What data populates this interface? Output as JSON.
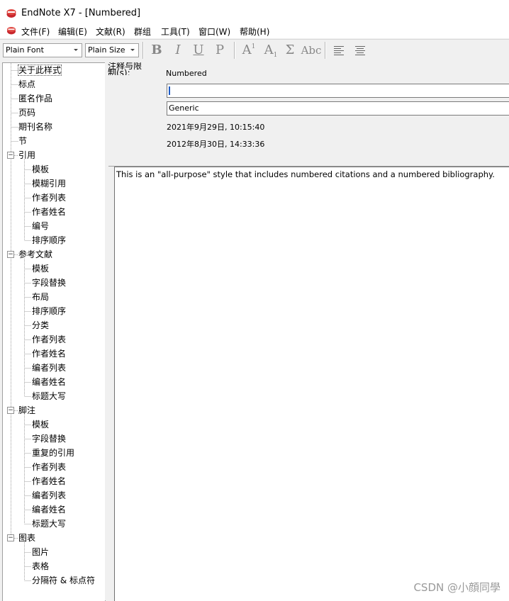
{
  "title_bar": {
    "title": "EndNote X7 - [Numbered]"
  },
  "menu": [
    "文件(F)",
    "编辑(E)",
    "文献(R)",
    "群组",
    "工具(T)",
    "窗口(W)",
    "帮助(H)"
  ],
  "toolbar": {
    "font_value": "Plain Font",
    "size_value": "Plain Size",
    "buttons": {
      "bold": "B",
      "italic": "I",
      "underline": "U",
      "plain": "P",
      "superscript": "A",
      "superscript_mark": "1",
      "subscript": "A",
      "subscript_mark": "1",
      "symbol": "Σ",
      "small_caps": "Abc"
    }
  },
  "tree": {
    "about": "关于此样式",
    "anonymous": "匿名作品",
    "page_numbers": "页码",
    "journal_names": "期刊名称",
    "sections": "节",
    "citations": {
      "label": "引用",
      "children": [
        "模板",
        "模糊引用",
        "作者列表",
        "作者姓名",
        "编号",
        "排序顺序"
      ]
    },
    "bibliography": {
      "label": "参考文献",
      "children": [
        "模板",
        "字段替换",
        "布局",
        "排序顺序",
        "分类",
        "作者列表",
        "作者姓名",
        "编者列表",
        "编者姓名",
        "标题大写"
      ]
    },
    "footnotes": {
      "label": "脚注",
      "children": [
        "模板",
        "字段替换",
        "重复的引用",
        "作者列表",
        "作者姓名",
        "编者列表",
        "编者姓名",
        "标题大写"
      ]
    },
    "figures_tables": {
      "label": "图表",
      "children": [
        "图片",
        "表格",
        "分隔符 & 标点符"
      ]
    },
    "punctuation": "标点"
  },
  "style_info": {
    "clipped_label": "注释与限制(s):",
    "name": "Numbered",
    "input_value": "",
    "category": "Generic",
    "created": "2021年9月29日, 10:15:40",
    "modified": "2012年8月30日, 14:33:36",
    "description": "This is an \"all-purpose\" style that includes numbered citations and a numbered bibliography."
  },
  "watermark": "CSDN @小顔同學"
}
